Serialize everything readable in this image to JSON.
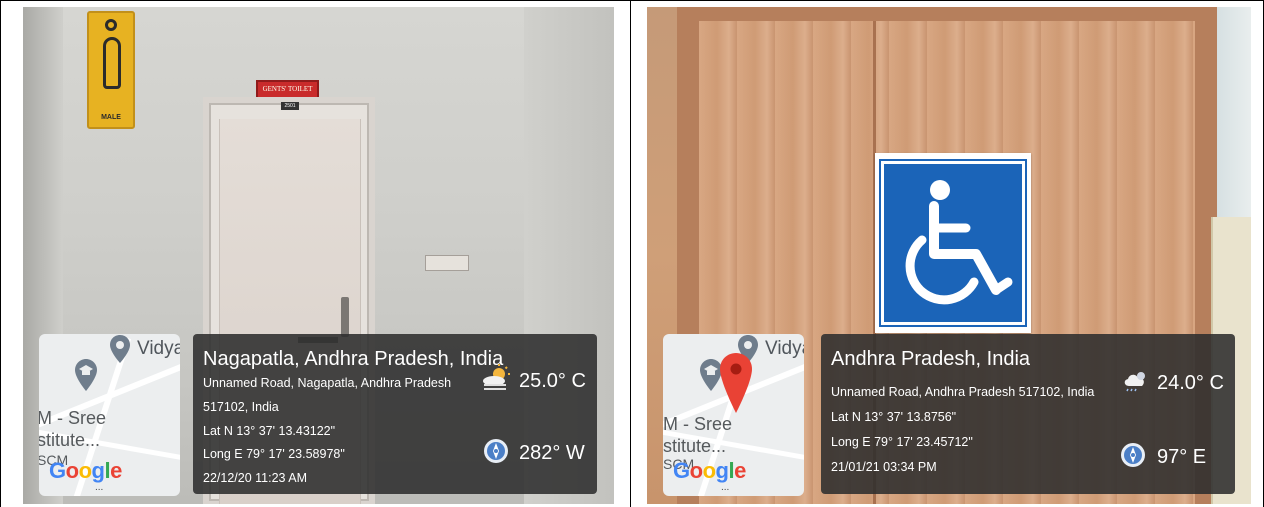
{
  "panels": [
    {
      "sign_male_text": "MALE",
      "sign_gents_text": "GENTS' TOILET",
      "room_number": "2501",
      "map": {
        "place_top": "Vidya",
        "place_left_1": "M - Sree",
        "place_left_2": "stitute...",
        "place_left_3": "SCM",
        "logo": "Google",
        "ellipsis": "..."
      },
      "info": {
        "title": "Nagapatla, Andhra Pradesh, India",
        "address_line_1": "Unnamed Road, Nagapatla, Andhra Pradesh",
        "address_line_2": "517102, India",
        "lat": "Lat N 13° 37' 13.43122\"",
        "long": "Long E 79° 17' 23.58978\"",
        "datetime": "22/12/20 11:23 AM",
        "temperature": "25.0° C",
        "direction": "282° W",
        "weather_icon": "partly-sunny-icon",
        "compass_icon": "compass-icon"
      }
    },
    {
      "map": {
        "place_top": "Vidya",
        "place_left_1": "M - Sree",
        "place_left_2": "stitute...",
        "place_left_3": "SCM",
        "logo": "Google",
        "ellipsis": "..."
      },
      "info": {
        "title": "Andhra Pradesh, India",
        "address_line_1": "Unnamed Road, Andhra Pradesh 517102, India",
        "lat": "Lat N 13° 37' 13.8756\"",
        "long": "Long E 79° 17' 23.45712\"",
        "datetime": "21/01/21 03:34 PM",
        "temperature": "24.0° C",
        "direction": "97° E",
        "weather_icon": "cloudy-night-icon",
        "compass_icon": "compass-icon"
      }
    }
  ],
  "colors": {
    "overlay": "#2d2d2d",
    "male_sign": "#e7b222",
    "wheelchair_sign": "#1b64b8",
    "door_wood": "#cf9b75",
    "map_pin_red": "#e94235"
  }
}
